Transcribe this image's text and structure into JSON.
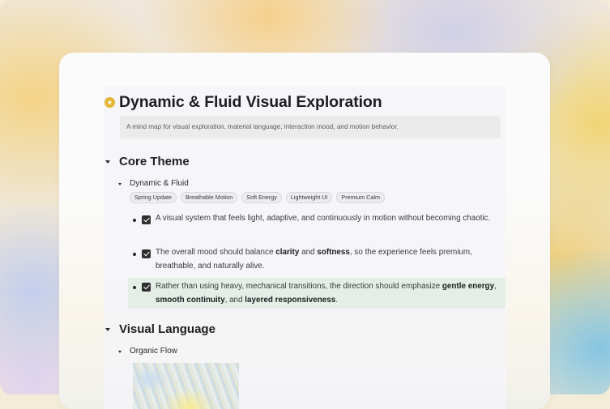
{
  "document": {
    "title_icon": "star-badge-icon",
    "title": "Dynamic & Fluid Visual Exploration",
    "subtitle": "A mind map for visual exploration, material language, interaction mood, and motion behavior."
  },
  "sections": [
    {
      "title": "Core Theme",
      "subsections": [
        {
          "title": "Dynamic & Fluid",
          "tags": [
            "Spring Update",
            "Breathable Motion",
            "Soft Energy",
            "Lightweight UI",
            "Premium Calm"
          ],
          "items": [
            {
              "checked": true,
              "parts": [
                {
                  "text": "A visual system that feels light, adaptive, and continuously in motion without becoming chaotic.",
                  "bold": false
                }
              ]
            },
            {
              "checked": true,
              "parts": [
                {
                  "text": "The overall mood should balance ",
                  "bold": false
                },
                {
                  "text": "clarity",
                  "bold": true
                },
                {
                  "text": " and ",
                  "bold": false
                },
                {
                  "text": "softness",
                  "bold": true
                },
                {
                  "text": ", so the experience feels premium, breathable, and naturally alive.",
                  "bold": false
                }
              ]
            },
            {
              "checked": true,
              "highlighted": true,
              "parts": [
                {
                  "text": "Rather than using heavy, mechanical transitions, the direction should emphasize ",
                  "bold": false
                },
                {
                  "text": "gentle energy",
                  "bold": true
                },
                {
                  "text": ", ",
                  "bold": false
                },
                {
                  "text": "smooth continuity",
                  "bold": true
                },
                {
                  "text": ", and ",
                  "bold": false
                },
                {
                  "text": "layered responsiveness",
                  "bold": true
                },
                {
                  "text": ".",
                  "bold": false
                }
              ]
            }
          ]
        }
      ]
    },
    {
      "title": "Visual Language",
      "subsections": [
        {
          "title": "Organic Flow"
        }
      ]
    }
  ],
  "colors": {
    "accent": "#e2b634",
    "text": "#1d1d1f",
    "highlight": "#e1ece4"
  }
}
